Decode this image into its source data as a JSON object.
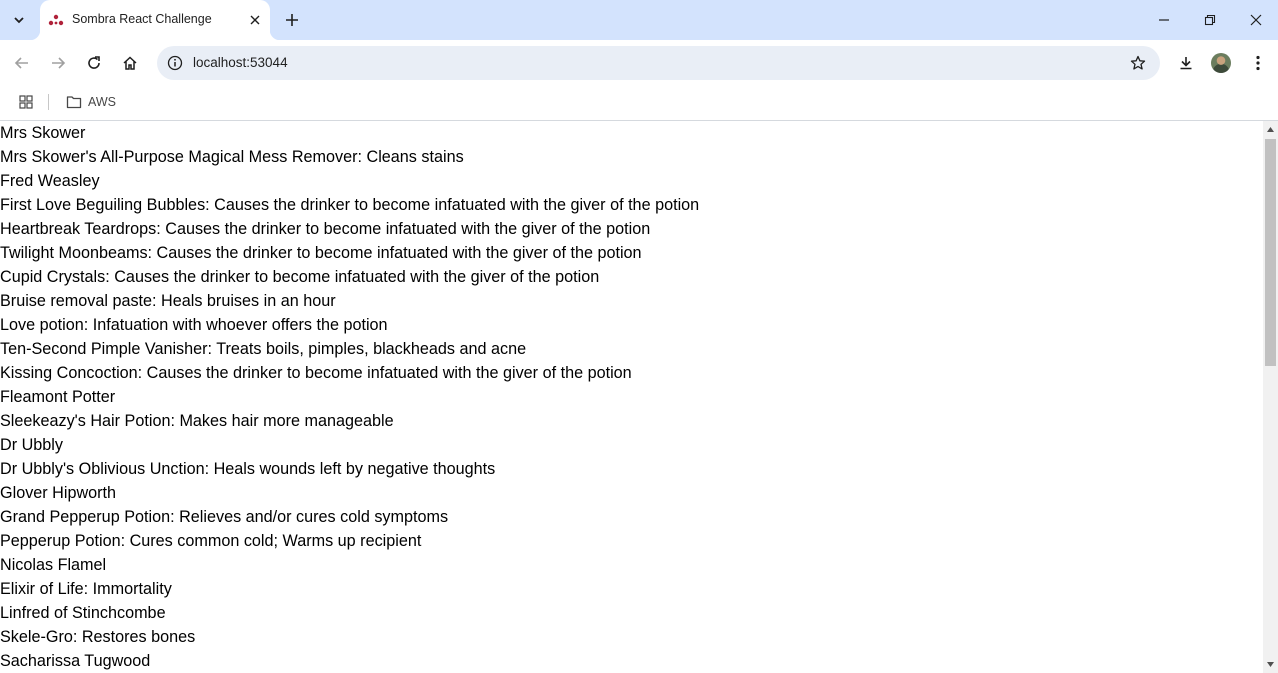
{
  "browser": {
    "tab": {
      "title": "Sombra React Challenge"
    },
    "address_bar": {
      "url": "localhost:53044"
    },
    "bookmarks": [
      {
        "label": "AWS"
      }
    ]
  },
  "colors": {
    "tabstrip_bg": "#d3e3fd",
    "omnibox_bg": "#e9eef6",
    "favicon": "#b0223a"
  },
  "icons": {
    "tab_search": "chevron-down-icon",
    "favicon": "react-dots-icon",
    "tab_close": "close-icon",
    "new_tab": "plus-icon",
    "back": "arrow-left-icon",
    "forward": "arrow-right-icon",
    "reload": "reload-icon",
    "home": "home-icon",
    "site_info": "info-icon",
    "bookmark": "star-icon",
    "downloads": "download-icon",
    "menu": "kebab-menu-icon",
    "apps": "apps-grid-icon",
    "folder": "folder-icon"
  },
  "page": {
    "lines": [
      {
        "type": "wizard",
        "text": "Mrs Skower"
      },
      {
        "type": "potion",
        "text": "Mrs Skower's All-Purpose Magical Mess Remover: Cleans stains"
      },
      {
        "type": "wizard",
        "text": "Fred Weasley"
      },
      {
        "type": "potion",
        "text": "First Love Beguiling Bubbles: Causes the drinker to become infatuated with the giver of the potion"
      },
      {
        "type": "potion",
        "text": "Heartbreak Teardrops: Causes the drinker to become infatuated with the giver of the potion"
      },
      {
        "type": "potion",
        "text": "Twilight Moonbeams: Causes the drinker to become infatuated with the giver of the potion"
      },
      {
        "type": "potion",
        "text": "Cupid Crystals: Causes the drinker to become infatuated with the giver of the potion"
      },
      {
        "type": "potion",
        "text": "Bruise removal paste: Heals bruises in an hour"
      },
      {
        "type": "potion",
        "text": "Love potion: Infatuation with whoever offers the potion"
      },
      {
        "type": "potion",
        "text": "Ten-Second Pimple Vanisher: Treats boils, pimples, blackheads and acne"
      },
      {
        "type": "potion",
        "text": "Kissing Concoction: Causes the drinker to become infatuated with the giver of the potion"
      },
      {
        "type": "wizard",
        "text": "Fleamont Potter"
      },
      {
        "type": "potion",
        "text": "Sleekeazy's Hair Potion: Makes hair more manageable"
      },
      {
        "type": "wizard",
        "text": "Dr Ubbly"
      },
      {
        "type": "potion",
        "text": "Dr Ubbly's Oblivious Unction: Heals wounds left by negative thoughts"
      },
      {
        "type": "wizard",
        "text": "Glover Hipworth"
      },
      {
        "type": "potion",
        "text": "Grand Pepperup Potion: Relieves and/or cures cold symptoms"
      },
      {
        "type": "potion",
        "text": "Pepperup Potion: Cures common cold; Warms up recipient"
      },
      {
        "type": "wizard",
        "text": "Nicolas Flamel"
      },
      {
        "type": "potion",
        "text": "Elixir of Life: Immortality"
      },
      {
        "type": "wizard",
        "text": "Linfred of Stinchcombe"
      },
      {
        "type": "potion",
        "text": "Skele-Gro: Restores bones"
      },
      {
        "type": "wizard",
        "text": "Sacharissa Tugwood"
      }
    ]
  }
}
